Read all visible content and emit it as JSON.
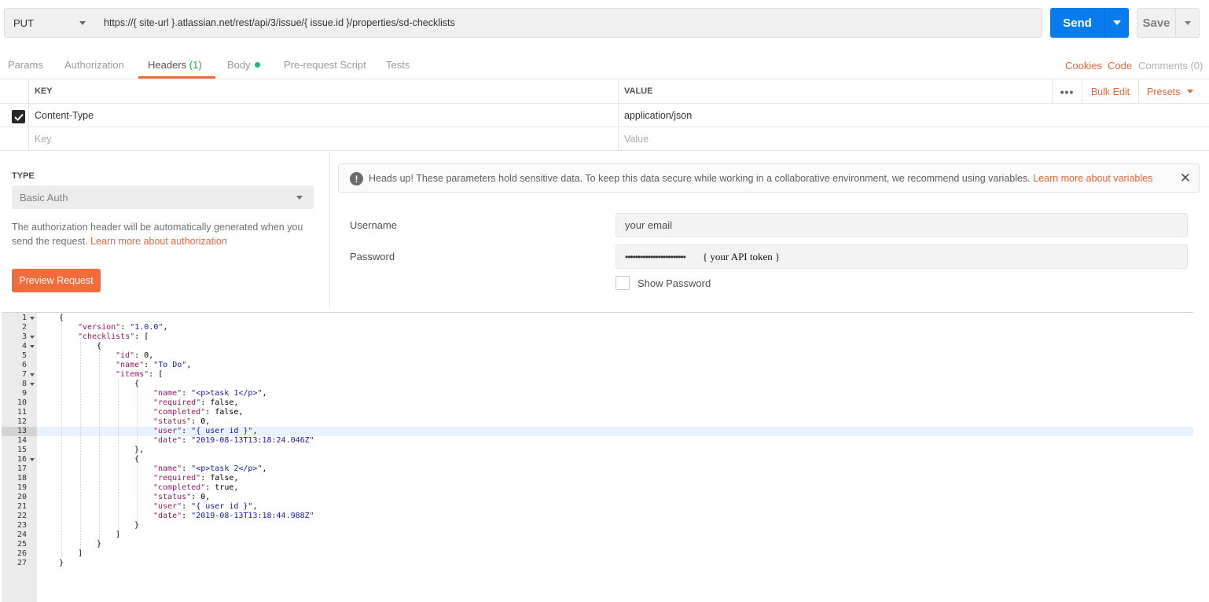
{
  "request": {
    "method": "PUT",
    "url": "https://{ site-url }.atlassian.net/rest/api/3/issue/{ issue.id }/properties/sd-checklists",
    "send_label": "Send",
    "save_label": "Save"
  },
  "tabs": {
    "params": "Params",
    "authorization": "Authorization",
    "headers": "Headers",
    "headers_count": "(1)",
    "body": "Body",
    "prerequest": "Pre-request Script",
    "tests": "Tests",
    "cookies": "Cookies",
    "code": "Code",
    "comments": "Comments (0)"
  },
  "headers_table": {
    "key_header": "KEY",
    "value_header": "VALUE",
    "ellipsis": "•••",
    "bulk_edit": "Bulk Edit",
    "presets": "Presets",
    "rows": [
      {
        "key": "Content-Type",
        "value": "application/json",
        "checked": true
      }
    ],
    "key_placeholder": "Key",
    "value_placeholder": "Value"
  },
  "auth": {
    "type_label": "TYPE",
    "type_value": "Basic Auth",
    "description": "The authorization header will be automatically generated when you send the request.",
    "learn_link": "Learn more about authorization",
    "preview_button": "Preview Request",
    "alert_text": "Heads up! These parameters hold sensitive data. To keep this data secure while working in a collaborative environment, we recommend using variables.",
    "alert_link": "Learn more about variables",
    "username_label": "Username",
    "username_value": "your email",
    "password_label": "Password",
    "password_dots": "••••••••••••••••••••••••",
    "password_note": "{ your API token }",
    "show_password": "Show Password"
  },
  "colors": {
    "accent": "#f26b3a",
    "send": "#097bed",
    "json_key": "#931a68",
    "json_string": "#1a1aa6"
  },
  "editor": {
    "active_line": 13,
    "lines": [
      {
        "n": "1",
        "fold": true,
        "indent": 0,
        "tokens": [
          [
            "p",
            "{"
          ]
        ]
      },
      {
        "n": "2",
        "fold": false,
        "indent": 1,
        "tokens": [
          [
            "k",
            "\"version\""
          ],
          [
            "p",
            ": "
          ],
          [
            "s",
            "\"1.0.0\""
          ],
          [
            "p",
            ","
          ]
        ]
      },
      {
        "n": "3",
        "fold": true,
        "indent": 1,
        "tokens": [
          [
            "k",
            "\"checklists\""
          ],
          [
            "p",
            ": ["
          ]
        ]
      },
      {
        "n": "4",
        "fold": true,
        "indent": 2,
        "tokens": [
          [
            "p",
            "{"
          ]
        ]
      },
      {
        "n": "5",
        "fold": false,
        "indent": 3,
        "tokens": [
          [
            "k",
            "\"id\""
          ],
          [
            "p",
            ": 0,"
          ]
        ]
      },
      {
        "n": "6",
        "fold": false,
        "indent": 3,
        "tokens": [
          [
            "k",
            "\"name\""
          ],
          [
            "p",
            ": "
          ],
          [
            "s",
            "\"To Do\""
          ],
          [
            "p",
            ","
          ]
        ]
      },
      {
        "n": "7",
        "fold": true,
        "indent": 3,
        "tokens": [
          [
            "k",
            "\"items\""
          ],
          [
            "p",
            ": ["
          ]
        ]
      },
      {
        "n": "8",
        "fold": true,
        "indent": 4,
        "tokens": [
          [
            "p",
            "{"
          ]
        ]
      },
      {
        "n": "9",
        "fold": false,
        "indent": 5,
        "tokens": [
          [
            "k",
            "\"name\""
          ],
          [
            "p",
            ": "
          ],
          [
            "s",
            "\"<p>task 1</p>\""
          ],
          [
            "p",
            ","
          ]
        ]
      },
      {
        "n": "10",
        "fold": false,
        "indent": 5,
        "tokens": [
          [
            "k",
            "\"required\""
          ],
          [
            "p",
            ": false,"
          ]
        ]
      },
      {
        "n": "11",
        "fold": false,
        "indent": 5,
        "tokens": [
          [
            "k",
            "\"completed\""
          ],
          [
            "p",
            ": false,"
          ]
        ]
      },
      {
        "n": "12",
        "fold": false,
        "indent": 5,
        "tokens": [
          [
            "k",
            "\"status\""
          ],
          [
            "p",
            ": 0,"
          ]
        ]
      },
      {
        "n": "13",
        "fold": false,
        "indent": 5,
        "tokens": [
          [
            "k",
            "\"user\""
          ],
          [
            "p",
            ": "
          ],
          [
            "s",
            "\"{ user id }\""
          ],
          [
            "p",
            ","
          ]
        ]
      },
      {
        "n": "14",
        "fold": false,
        "indent": 5,
        "tokens": [
          [
            "k",
            "\"date\""
          ],
          [
            "p",
            ": "
          ],
          [
            "s",
            "\"2019-08-13T13:18:24.046Z\""
          ]
        ]
      },
      {
        "n": "15",
        "fold": false,
        "indent": 4,
        "tokens": [
          [
            "p",
            "},"
          ]
        ]
      },
      {
        "n": "16",
        "fold": true,
        "indent": 4,
        "tokens": [
          [
            "p",
            "{"
          ]
        ]
      },
      {
        "n": "17",
        "fold": false,
        "indent": 5,
        "tokens": [
          [
            "k",
            "\"name\""
          ],
          [
            "p",
            ": "
          ],
          [
            "s",
            "\"<p>task 2</p>\""
          ],
          [
            "p",
            ","
          ]
        ]
      },
      {
        "n": "18",
        "fold": false,
        "indent": 5,
        "tokens": [
          [
            "k",
            "\"required\""
          ],
          [
            "p",
            ": false,"
          ]
        ]
      },
      {
        "n": "19",
        "fold": false,
        "indent": 5,
        "tokens": [
          [
            "k",
            "\"completed\""
          ],
          [
            "p",
            ": true,"
          ]
        ]
      },
      {
        "n": "20",
        "fold": false,
        "indent": 5,
        "tokens": [
          [
            "k",
            "\"status\""
          ],
          [
            "p",
            ": 0,"
          ]
        ]
      },
      {
        "n": "21",
        "fold": false,
        "indent": 5,
        "tokens": [
          [
            "k",
            "\"user\""
          ],
          [
            "p",
            ": "
          ],
          [
            "s",
            "\"{ user id }\""
          ],
          [
            "p",
            ","
          ]
        ]
      },
      {
        "n": "22",
        "fold": false,
        "indent": 5,
        "tokens": [
          [
            "k",
            "\"date\""
          ],
          [
            "p",
            ": "
          ],
          [
            "s",
            "\"2019-08-13T13:18:44.988Z\""
          ]
        ]
      },
      {
        "n": "23",
        "fold": false,
        "indent": 4,
        "tokens": [
          [
            "p",
            "}"
          ]
        ]
      },
      {
        "n": "24",
        "fold": false,
        "indent": 3,
        "tokens": [
          [
            "p",
            "]"
          ]
        ]
      },
      {
        "n": "25",
        "fold": false,
        "indent": 2,
        "tokens": [
          [
            "p",
            "}"
          ]
        ]
      },
      {
        "n": "26",
        "fold": false,
        "indent": 1,
        "tokens": [
          [
            "p",
            "]"
          ]
        ]
      },
      {
        "n": "27",
        "fold": false,
        "indent": 0,
        "tokens": [
          [
            "p",
            "}"
          ]
        ]
      }
    ]
  }
}
